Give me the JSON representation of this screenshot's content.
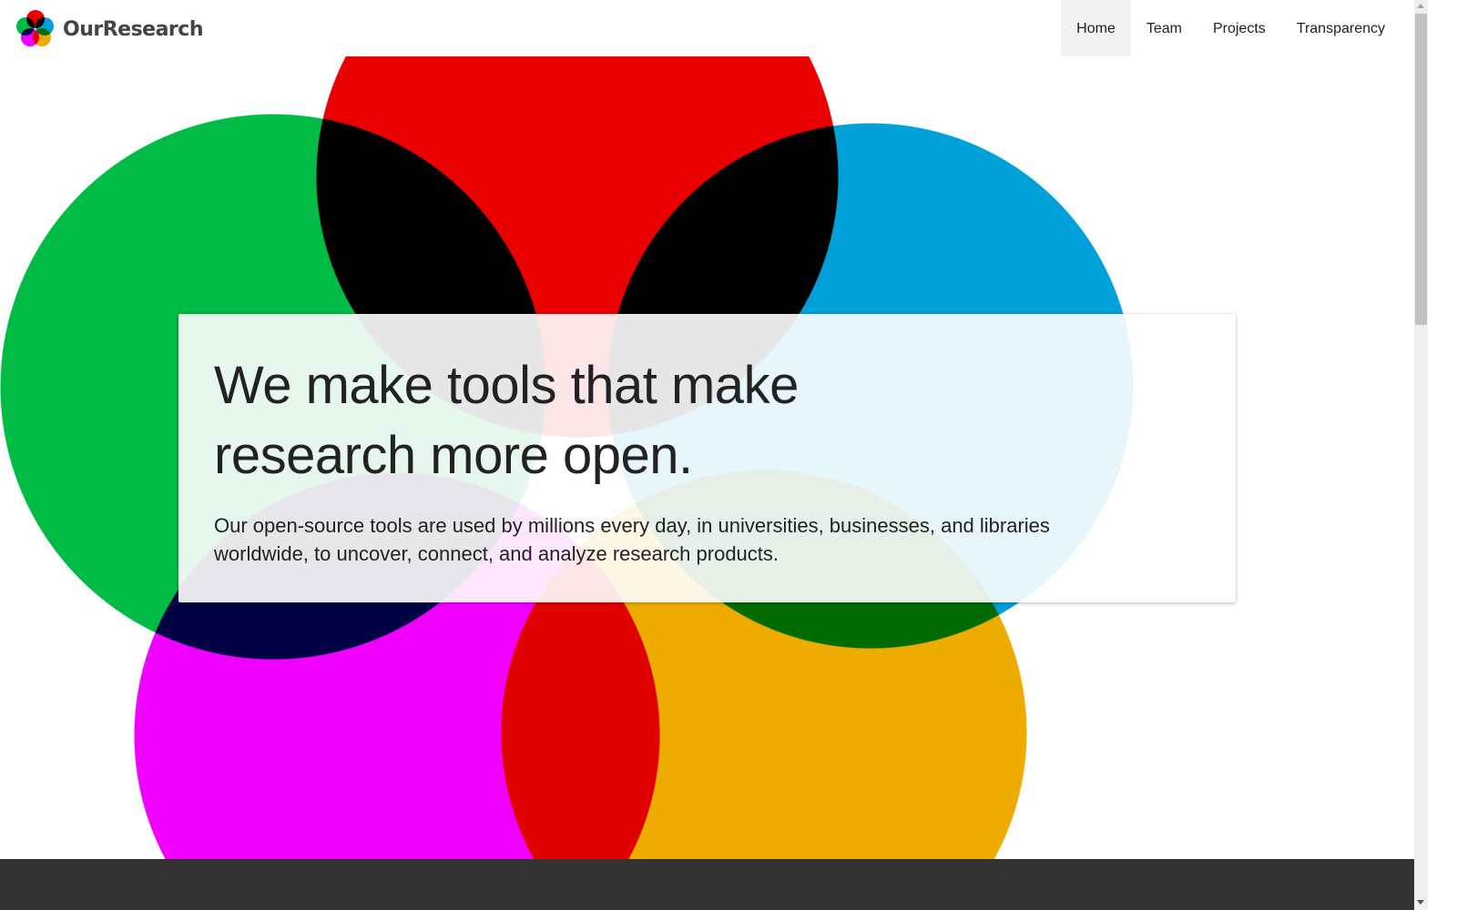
{
  "brand": {
    "name": "OurResearch"
  },
  "nav": {
    "items": [
      {
        "label": "Home",
        "active": true
      },
      {
        "label": "Team"
      },
      {
        "label": "Projects"
      },
      {
        "label": "Transparency"
      }
    ]
  },
  "hero": {
    "headline": "We make tools that make research more open.",
    "subtext": "Our open-source tools are used by millions every day, in universities, businesses, and libraries worldwide, to uncover, connect, and analyze research products."
  },
  "colors": {
    "green": "#00bb44",
    "red": "#ea0000",
    "blue": "#00a0d8",
    "magenta": "#f000ff",
    "orange": "#efac00",
    "footer": "#333333"
  }
}
